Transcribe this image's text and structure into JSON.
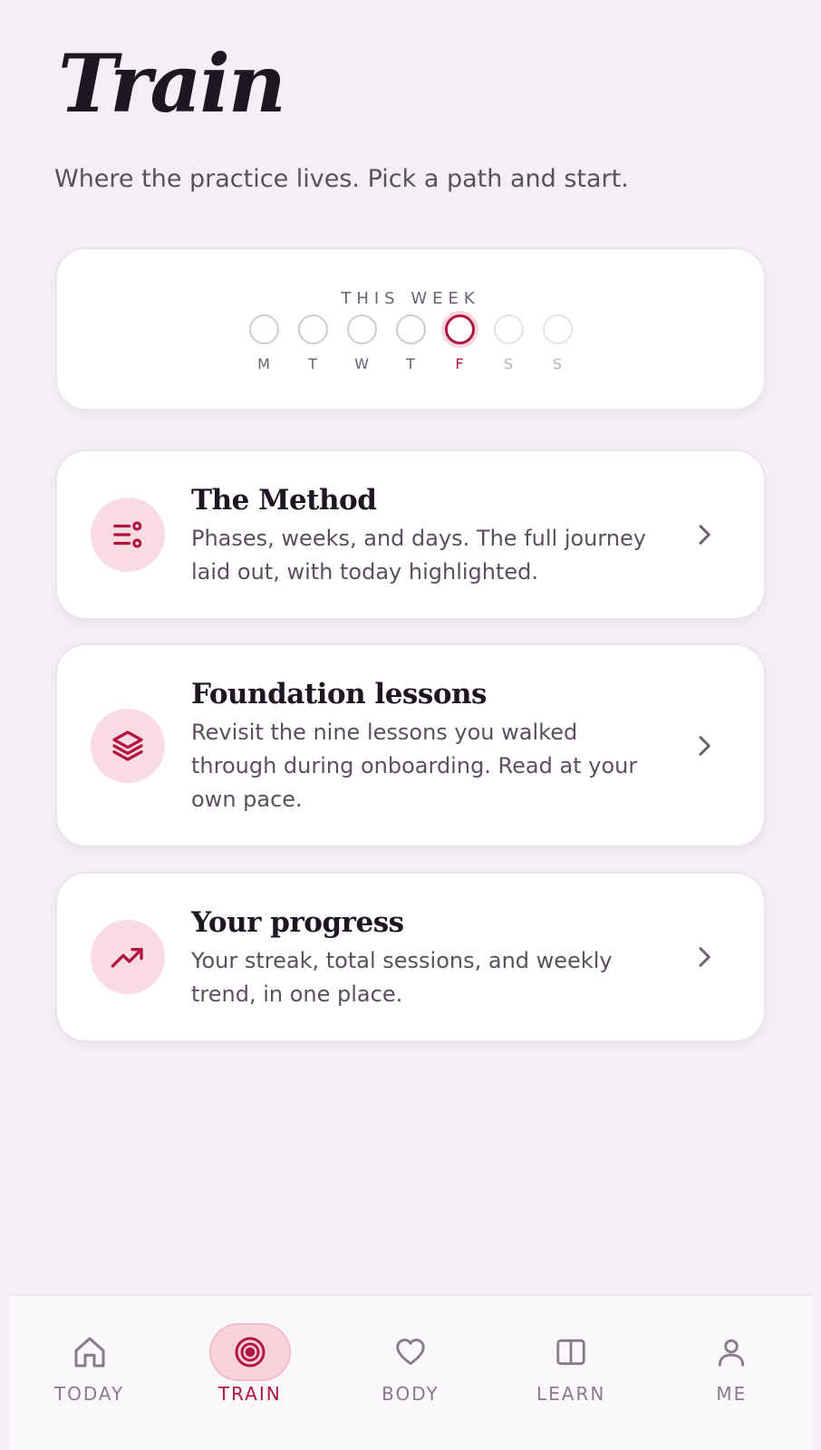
{
  "header": {
    "title": "Train",
    "subtitle": "Where the practice lives. Pick a path and start."
  },
  "week": {
    "label": "THIS WEEK",
    "days": [
      {
        "letter": "M",
        "state": "past"
      },
      {
        "letter": "T",
        "state": "past"
      },
      {
        "letter": "W",
        "state": "past"
      },
      {
        "letter": "T",
        "state": "past"
      },
      {
        "letter": "F",
        "state": "today"
      },
      {
        "letter": "S",
        "state": "future"
      },
      {
        "letter": "S",
        "state": "future"
      }
    ]
  },
  "menu": [
    {
      "title": "The Method",
      "description": "Phases, weeks, and days. The full journey laid out, with today highlighted.",
      "icon": "sliders-icon"
    },
    {
      "title": "Foundation lessons",
      "description": "Revisit the nine lessons you walked through during onboarding. Read at your own pace.",
      "icon": "layers-icon"
    },
    {
      "title": "Your progress",
      "description": "Your streak, total sessions, and weekly trend, in one place.",
      "icon": "trending-up-icon"
    }
  ],
  "nav": {
    "items": [
      {
        "label": "TODAY",
        "icon": "home-icon"
      },
      {
        "label": "TRAIN",
        "icon": "target-icon",
        "active": true
      },
      {
        "label": "BODY",
        "icon": "heart-icon"
      },
      {
        "label": "LEARN",
        "icon": "book-icon"
      },
      {
        "label": "ME",
        "icon": "user-icon"
      }
    ]
  },
  "colors": {
    "accent": "#b0163f",
    "accent_soft": "#f9dce3",
    "background": "#f4eff6"
  }
}
